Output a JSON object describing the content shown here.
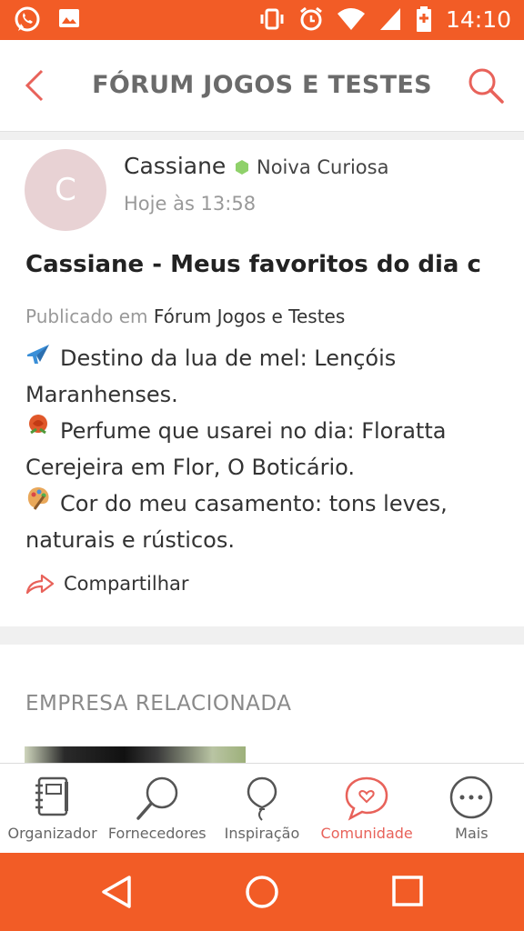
{
  "status_bar": {
    "time": "14:10",
    "icons": [
      "whatsapp-icon",
      "image-icon",
      "vibrate-icon",
      "alarm-icon",
      "wifi-icon",
      "signal-icon",
      "battery-icon"
    ]
  },
  "header": {
    "title": "FÓRUM JOGOS E TESTES",
    "back_icon": "chevron-left-icon",
    "search_icon": "search-icon"
  },
  "post": {
    "avatar_letter": "C",
    "author": "Cassiane",
    "badge": "Noiva Curiosa",
    "timestamp": "Hoje às 13:58",
    "title": "Cassiane - Meus favoritos do dia c",
    "published_prefix": "Publicado em",
    "forum": "Fórum Jogos e Testes",
    "body": [
      {
        "emoji": "✈",
        "text": "Destino da lua de mel: Lençóis Maranhenses."
      },
      {
        "emoji": "🌹",
        "text": "Perfume que usarei no dia: Floratta Cerejeira em Flor, O Boticário."
      },
      {
        "emoji": "🎨",
        "text": "Cor do meu casamento: tons leves, naturais e rústicos."
      }
    ],
    "share_label": "Compartilhar"
  },
  "related": {
    "heading": "EMPRESA RELACIONADA"
  },
  "bottom_nav": {
    "items": [
      {
        "label": "Organizador",
        "icon": "planner-icon",
        "active": false
      },
      {
        "label": "Fornecedores",
        "icon": "search-icon",
        "active": false
      },
      {
        "label": "Inspiração",
        "icon": "balloon-icon",
        "active": false
      },
      {
        "label": "Comunidade",
        "icon": "chat-heart-icon",
        "active": true
      },
      {
        "label": "Mais",
        "icon": "more-icon",
        "active": false
      }
    ]
  },
  "colors": {
    "accent": "#f25c26",
    "active_tab": "#e8625a",
    "avatar_bg": "#e8d2d4",
    "badge_dot": "#8fd16a"
  }
}
